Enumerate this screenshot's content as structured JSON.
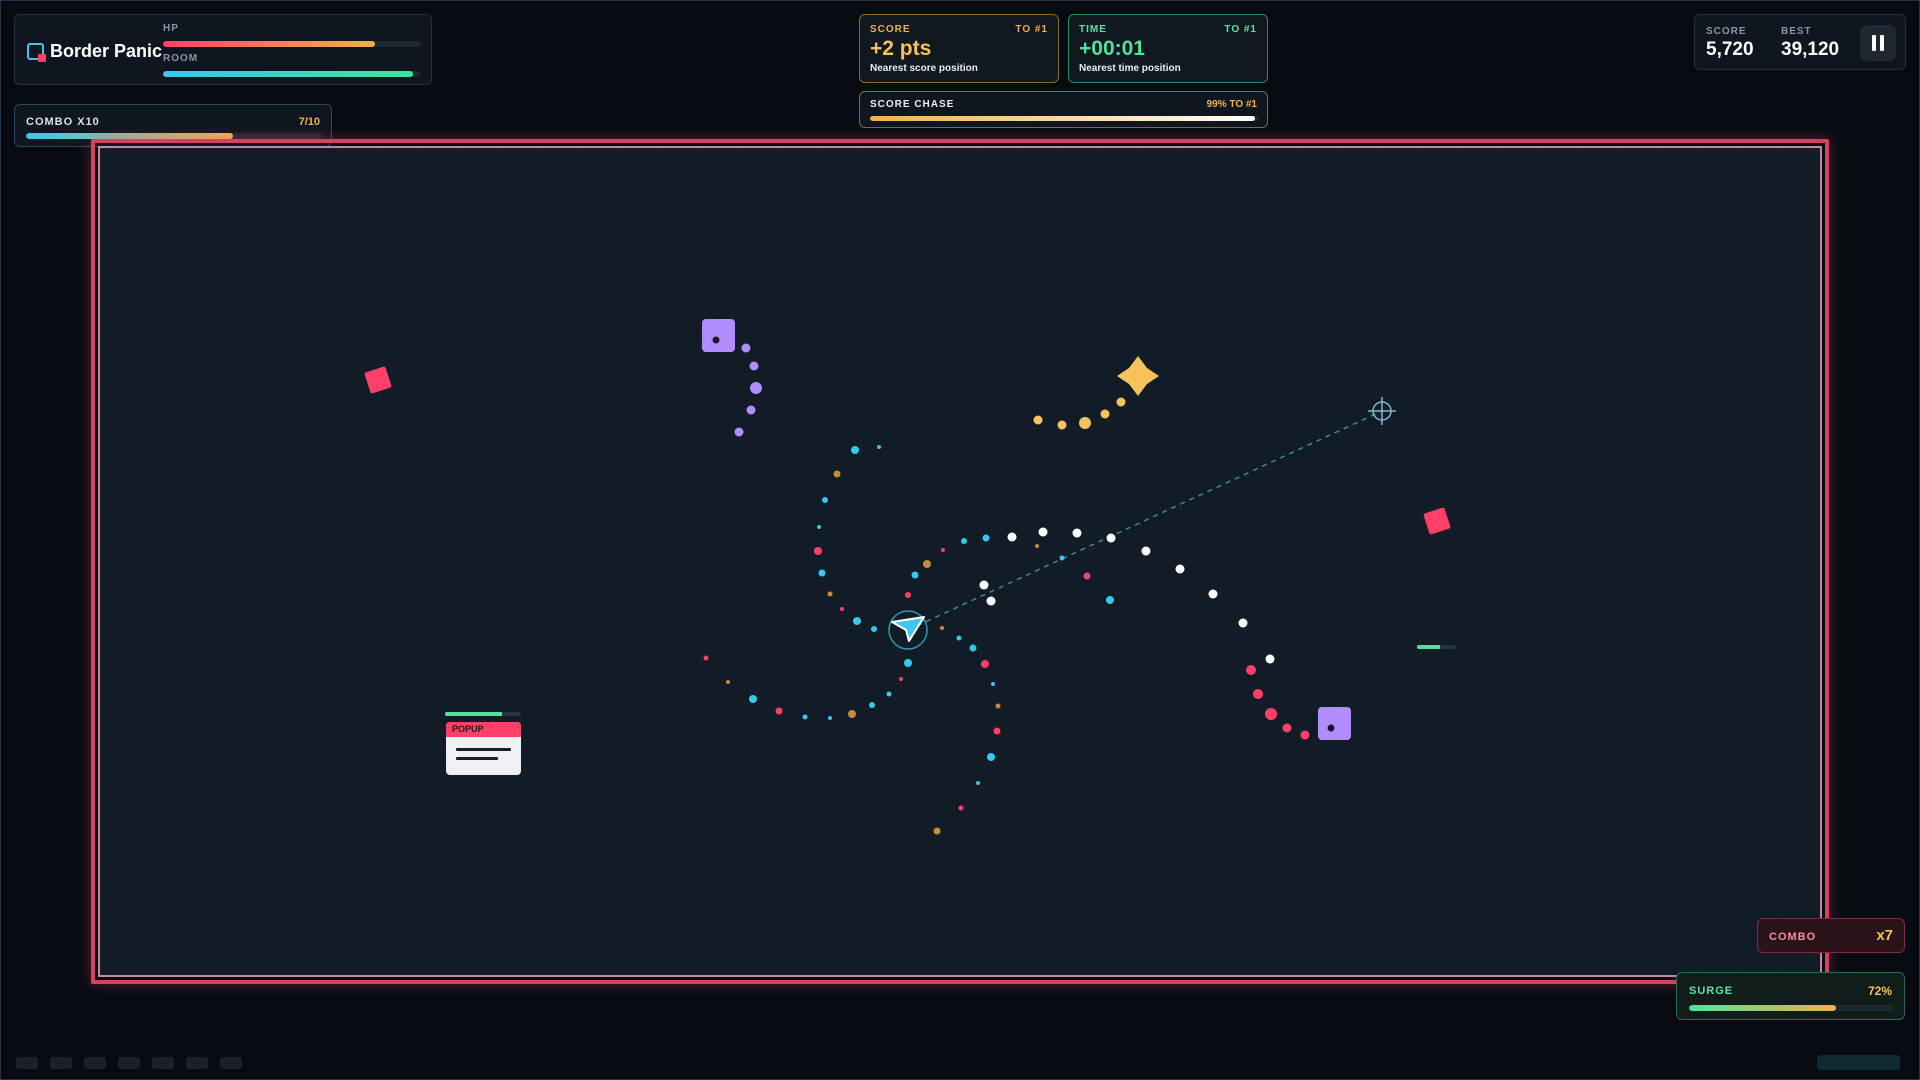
{
  "app": {
    "title": "Border Panic"
  },
  "status": {
    "hp_label": "HP",
    "hp_fraction": 0.82,
    "room_label": "ROOM",
    "room_fraction": 0.97
  },
  "combo_meter": {
    "label": "COMBO X10",
    "count": "7/10",
    "fraction": 0.7
  },
  "leaderboard": {
    "score_target": {
      "label": "SCORE",
      "rank": "TO #1",
      "value": "+2 pts",
      "caption": "Nearest score position"
    },
    "time_target": {
      "label": "TIME",
      "rank": "TO #1",
      "value": "+00:01",
      "caption": "Nearest time position"
    },
    "chase": {
      "label": "SCORE CHASE",
      "percent_text": "99% TO #1",
      "fraction": 0.99
    }
  },
  "scoreboard": {
    "score_label": "SCORE",
    "score": "5,720",
    "best_label": "BEST",
    "best": "39,120"
  },
  "pause_icon": "pause-icon",
  "enemies": {
    "popup_label": "POPUP",
    "popup_health_fraction": 0.75,
    "enemy2_health_fraction": 0.6
  },
  "combo_badge": {
    "label": "COMBO",
    "value": "x7"
  },
  "surge": {
    "label": "SURGE",
    "percent_text": "72%",
    "fraction": 0.72
  },
  "colors": {
    "arena_border": "#d2435f",
    "player": "#3fc7ea",
    "enemy_red": "#ff3f67",
    "enemy_purple": "#b18cff",
    "pickup_gold": "#f6c25a"
  }
}
